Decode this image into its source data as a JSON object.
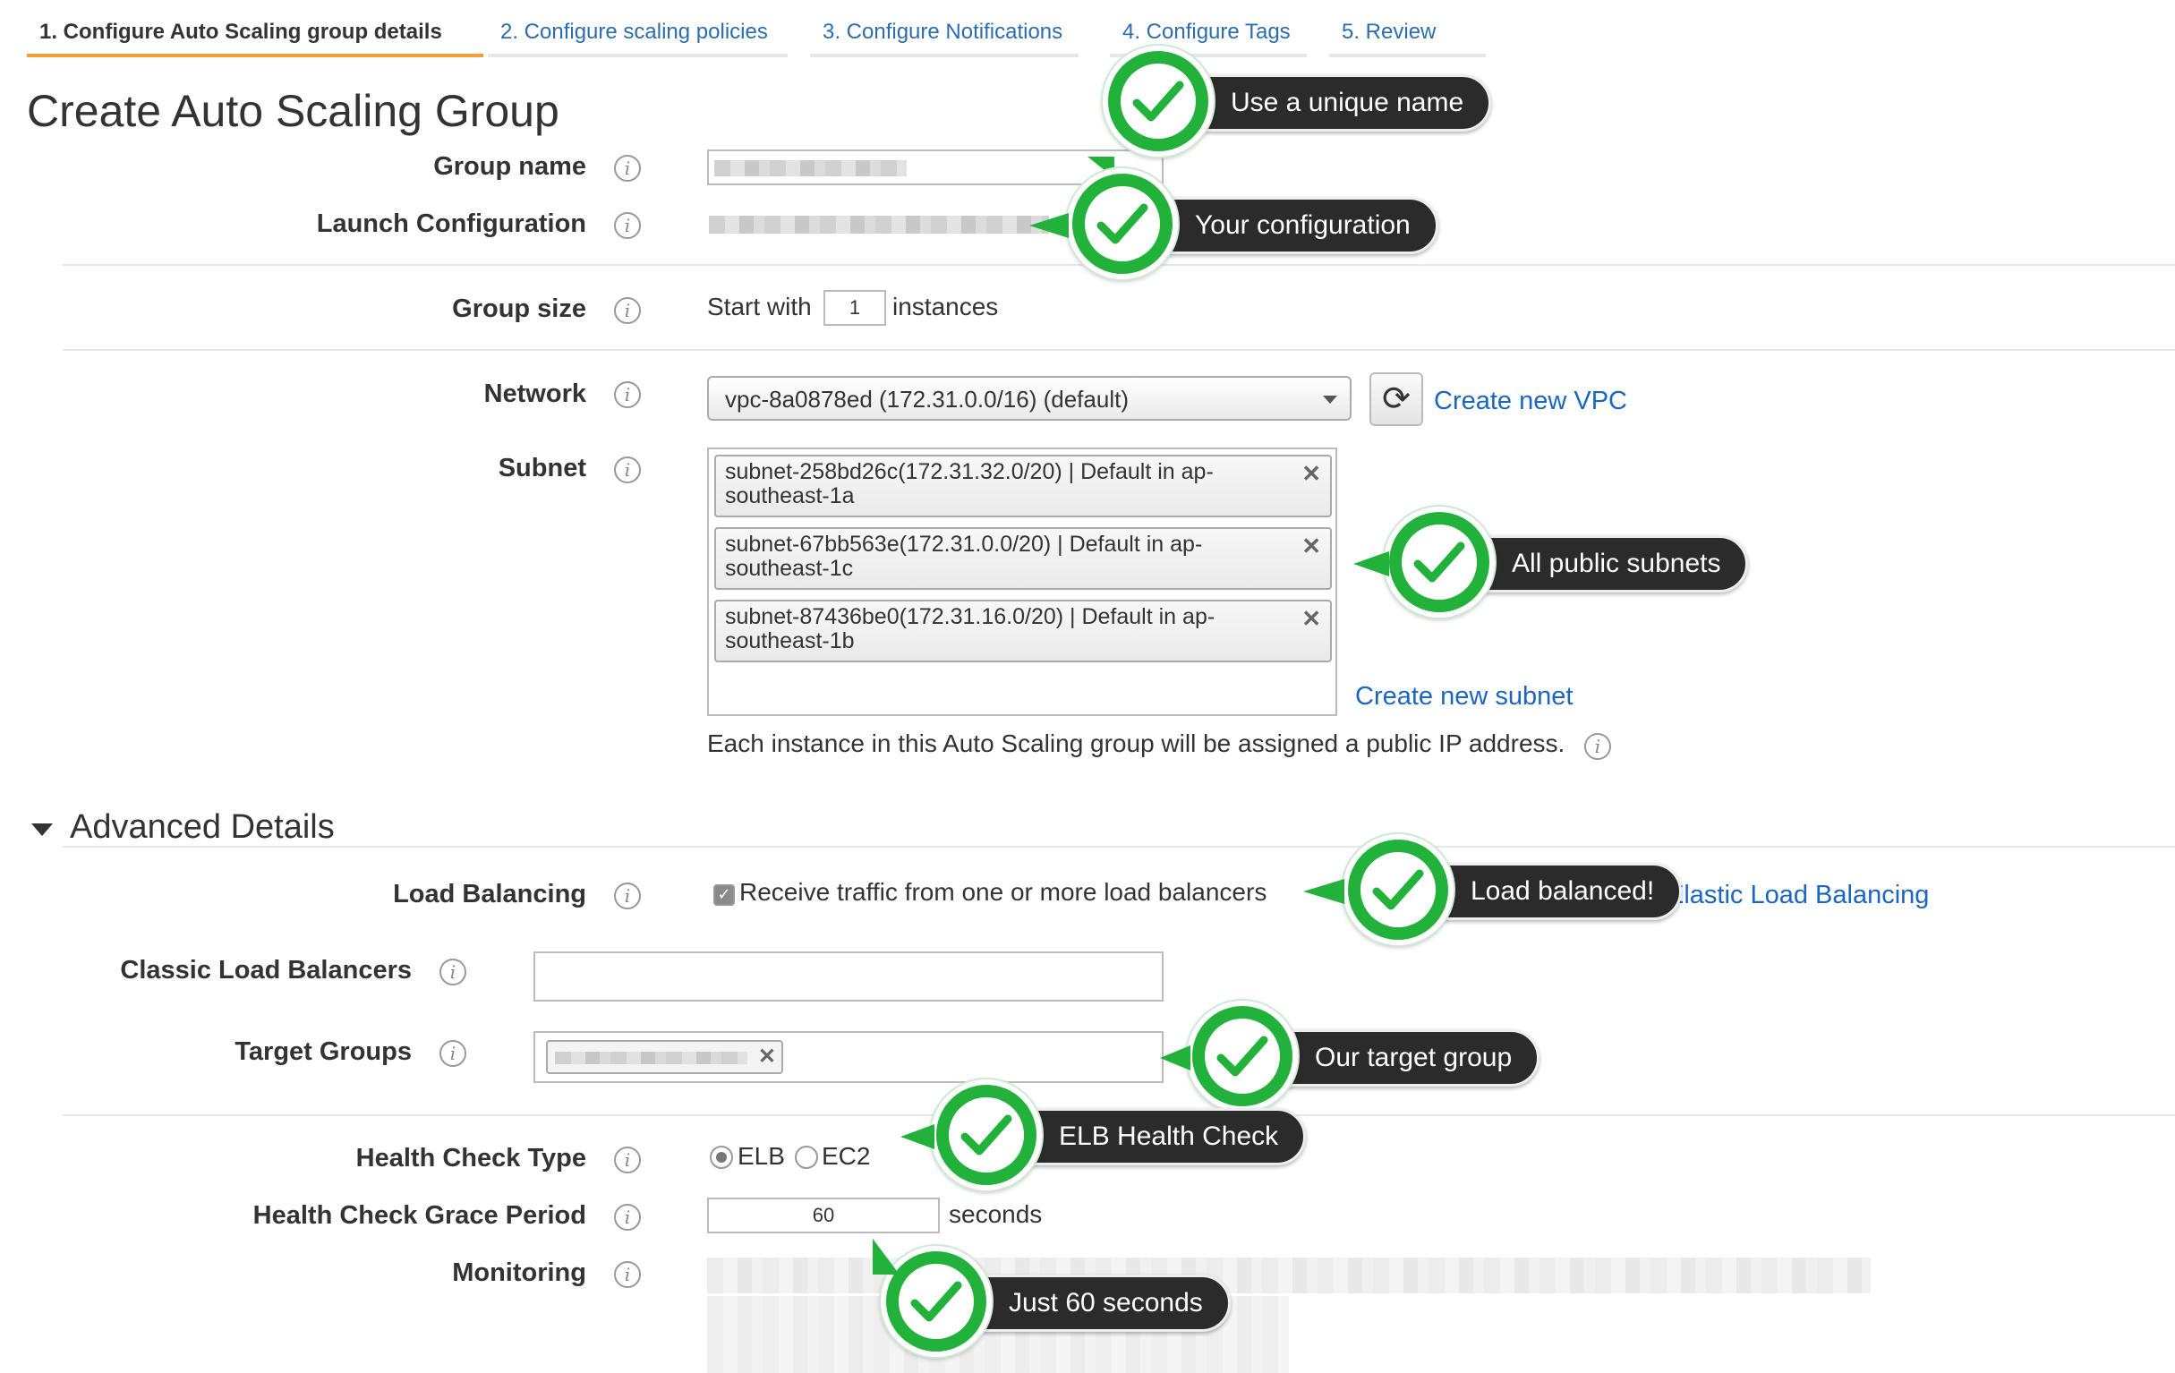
{
  "tabs": [
    {
      "label": "1. Configure Auto Scaling group details",
      "active": true
    },
    {
      "label": "2. Configure scaling policies"
    },
    {
      "label": "3. Configure Notifications"
    },
    {
      "label": "4. Configure Tags"
    },
    {
      "label": "5. Review"
    }
  ],
  "title": "Create Auto Scaling Group",
  "form": {
    "group_name_label": "Group name",
    "launch_config_label": "Launch Configuration",
    "group_size_label": "Group size",
    "start_with": "Start with",
    "instances_value": "1",
    "instances_suffix": "instances",
    "network_label": "Network",
    "network_value": "vpc-8a0878ed (172.31.0.0/16) (default)",
    "create_vpc": "Create new VPC",
    "subnet_label": "Subnet",
    "subnets": [
      "subnet-258bd26c(172.31.32.0/20) | Default in ap-southeast-1a",
      "subnet-67bb563e(172.31.0.0/20) | Default in ap-southeast-1c",
      "subnet-87436be0(172.31.16.0/20) | Default in ap-southeast-1b"
    ],
    "create_subnet": "Create new subnet",
    "public_ip_note": "Each instance in this Auto Scaling group will be assigned a public IP address."
  },
  "advanced": {
    "title": "Advanced Details",
    "load_balancing_label": "Load Balancing",
    "load_balancing_checkbox": "Receive traffic from one or more load balancers",
    "elb_link": "Elastic Load Balancing",
    "classic_lb_label": "Classic Load Balancers",
    "target_groups_label": "Target Groups",
    "health_check_type_label": "Health Check Type",
    "hc_elb": "ELB",
    "hc_ec2": "EC2",
    "grace_label": "Health Check Grace Period",
    "grace_value": "60",
    "grace_unit": "seconds",
    "monitoring_label": "Monitoring"
  },
  "callouts": {
    "unique_name": "Use a unique name",
    "your_config": "Your configuration",
    "public_subnets": "All public subnets",
    "load_balanced": "Load balanced!",
    "target_group": "Our target group",
    "elb_health": "ELB Health Check",
    "sixty": "Just 60 seconds"
  },
  "colors": {
    "accent_tab": "#f0a037",
    "link": "#1a66c2",
    "badge_green": "#22b23c",
    "callout_bg": "#2b2b2b"
  },
  "icons": [
    "info-icon",
    "refresh-icon",
    "close-icon",
    "check-icon",
    "checkmark-badge-icon",
    "triangle-down-icon"
  ]
}
